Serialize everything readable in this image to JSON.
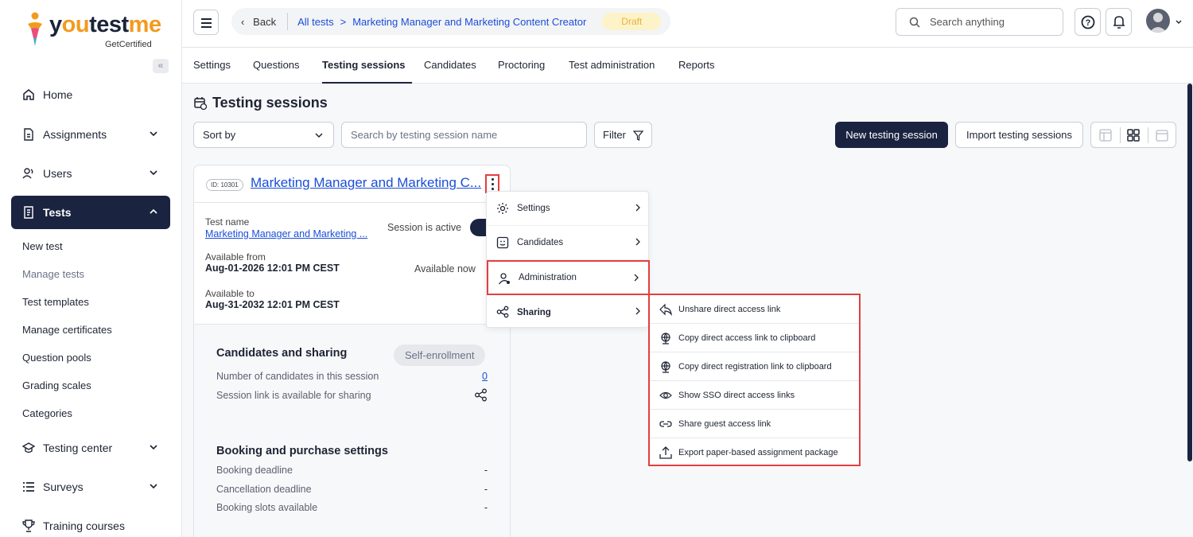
{
  "logo": {
    "name_part1": "y",
    "name_o": "ou",
    "name_part2": "test",
    "name_me": "me",
    "subtitle": "GetCertified"
  },
  "sidebar": {
    "collapse": "«",
    "items": [
      {
        "label": "Home"
      },
      {
        "label": "Assignments"
      },
      {
        "label": "Users"
      },
      {
        "label": "Tests"
      },
      {
        "label": "Testing center"
      },
      {
        "label": "Surveys"
      },
      {
        "label": "Training courses"
      }
    ],
    "sub_items": [
      {
        "label": "New test"
      },
      {
        "label": "Manage tests"
      },
      {
        "label": "Test templates"
      },
      {
        "label": "Manage certificates"
      },
      {
        "label": "Question pools"
      },
      {
        "label": "Grading scales"
      },
      {
        "label": "Categories"
      }
    ]
  },
  "header": {
    "back": "Back",
    "crumb_all": "All tests",
    "crumb_sep": ">",
    "crumb_current": "Marketing Manager and Marketing Content Creator",
    "status": "Draft",
    "search_placeholder": "Search anything"
  },
  "tabs": [
    "Settings",
    "Questions",
    "Testing sessions",
    "Candidates",
    "Proctoring",
    "Test administration",
    "Reports"
  ],
  "main": {
    "title": "Testing sessions",
    "sort_label": "Sort by",
    "search_placeholder": "Search by testing session name",
    "filter_label": "Filter",
    "new_button": "New testing session",
    "import_button": "Import testing sessions"
  },
  "card": {
    "id": "ID: 10301",
    "title": "Marketing Manager and Marketing C...",
    "test_name_label": "Test name",
    "test_name_value": "Marketing Manager and Marketing ...",
    "session_active": "Session is active",
    "available_from_label": "Available from",
    "available_from_value": "Aug-01-2026 12:01 PM CEST",
    "available_now": "Available now",
    "available_to_label": "Available to",
    "available_to_value": "Aug-31-2032 12:01 PM CEST",
    "candidates_heading": "Candidates and sharing",
    "self_enrollment": "Self-enrollment",
    "num_candidates_label": "Number of candidates in this session",
    "num_candidates_value": "0",
    "session_link_label": "Session link is available for sharing",
    "booking_heading": "Booking and purchase settings",
    "booking_deadline_label": "Booking deadline",
    "booking_deadline_value": "-",
    "cancel_deadline_label": "Cancellation deadline",
    "cancel_deadline_value": "-",
    "slots_label": "Booking slots available",
    "slots_value": "-"
  },
  "context_menu": [
    "Settings",
    "Candidates",
    "Administration",
    "Sharing"
  ],
  "sharing_menu": [
    "Unshare direct access link",
    "Copy direct access link to clipboard",
    "Copy direct registration link to clipboard",
    "Show SSO direct access links",
    "Share guest access link",
    "Export paper-based assignment package"
  ],
  "colors": {
    "navy": "#1a2340",
    "link": "#1a4ed8",
    "highlight": "#e53e3e",
    "draft_bg": "#fdf3c9",
    "draft_fg": "#e8b33a"
  }
}
